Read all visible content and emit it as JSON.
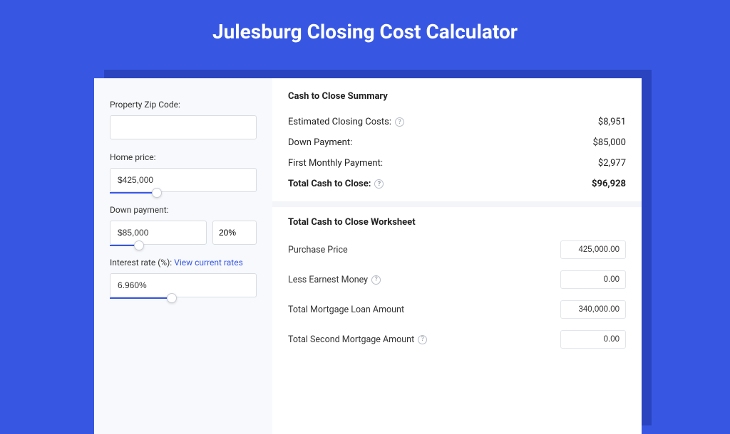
{
  "title": "Julesburg Closing Cost Calculator",
  "left": {
    "zip_label": "Property Zip Code:",
    "zip_value": "",
    "home_price_label": "Home price:",
    "home_price_value": "$425,000",
    "home_price_pct": 32,
    "down_payment_label": "Down payment:",
    "down_payment_value": "$85,000",
    "down_payment_pct_value": "20%",
    "down_payment_slider_pct": 30,
    "interest_label": "Interest rate (%):",
    "interest_link": "View current rates",
    "interest_value": "6.960%",
    "interest_slider_pct": 42
  },
  "summary": {
    "title": "Cash to Close Summary",
    "rows": [
      {
        "label": "Estimated Closing Costs:",
        "value": "$8,951",
        "help": true
      },
      {
        "label": "Down Payment:",
        "value": "$85,000",
        "help": false
      },
      {
        "label": "First Monthly Payment:",
        "value": "$2,977",
        "help": false
      }
    ],
    "total_label": "Total Cash to Close:",
    "total_value": "$96,928"
  },
  "worksheet": {
    "title": "Total Cash to Close Worksheet",
    "rows": [
      {
        "label": "Purchase Price",
        "value": "425,000.00",
        "help": false
      },
      {
        "label": "Less Earnest Money",
        "value": "0.00",
        "help": true
      },
      {
        "label": "Total Mortgage Loan Amount",
        "value": "340,000.00",
        "help": false
      },
      {
        "label": "Total Second Mortgage Amount",
        "value": "0.00",
        "help": true
      }
    ]
  }
}
